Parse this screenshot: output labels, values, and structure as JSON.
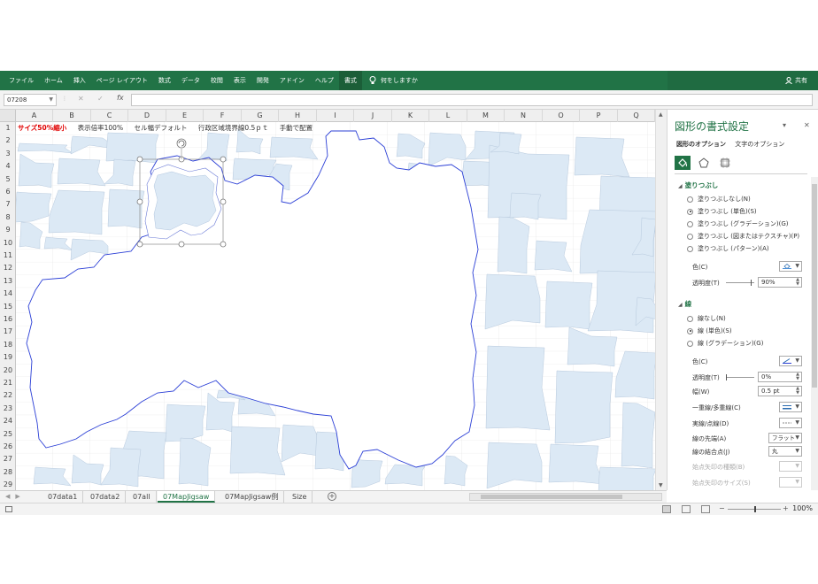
{
  "ribbon": {
    "tabs": [
      "ファイル",
      "ホーム",
      "挿入",
      "ページ レイアウト",
      "数式",
      "データ",
      "校閲",
      "表示",
      "開発",
      "アドイン",
      "ヘルプ",
      "書式"
    ],
    "active_tab": "書式",
    "tell_me": "何をしますか",
    "share": "共有"
  },
  "formula_bar": {
    "name_box": "07208",
    "formula": ""
  },
  "grid": {
    "columns": [
      "A",
      "B",
      "C",
      "D",
      "E",
      "F",
      "G",
      "H",
      "I",
      "J",
      "K",
      "L",
      "M",
      "N",
      "O",
      "P",
      "Q"
    ],
    "rows": [
      "1",
      "2",
      "3",
      "4",
      "5",
      "6",
      "7",
      "8",
      "9",
      "10",
      "11",
      "12",
      "13",
      "14",
      "15",
      "16",
      "17",
      "18",
      "19",
      "20",
      "21",
      "22",
      "23",
      "24",
      "25",
      "26",
      "27",
      "28",
      "29"
    ],
    "row1": {
      "red": "サイズ50%縮小",
      "zoom": "表示倍率100%",
      "cellwidth": "セル幅デフォルト",
      "border": "行政区域境界線0.5ｐｔ",
      "manual": "手動で配置"
    }
  },
  "sheets": {
    "tabs": [
      "07data1",
      "07data2",
      "07all",
      "07MapJigsaw",
      "07MapJigsaw例",
      "Size"
    ],
    "active": "07MapJigsaw"
  },
  "status": {
    "zoom": "100%"
  },
  "format_pane": {
    "title": "図形の書式設定",
    "tab_shape": "図形のオプション",
    "tab_text": "文字のオプション",
    "fill": {
      "section": "塗りつぶし",
      "options": [
        "塗りつぶしなし(N)",
        "塗りつぶし (単色)(S)",
        "塗りつぶし (グラデーション)(G)",
        "塗りつぶし (図またはテクスチャ)(P)",
        "塗りつぶし (パターン)(A)"
      ],
      "selected_index": 1,
      "color_label": "色(C)",
      "transparency_label": "透明度(T)",
      "transparency_value": "90%"
    },
    "line": {
      "section": "線",
      "options": [
        "線なし(N)",
        "線 (単色)(S)",
        "線 (グラデーション)(G)"
      ],
      "selected_index": 1,
      "color_label": "色(C)",
      "transparency_label": "透明度(T)",
      "transparency_value": "0%",
      "width_label": "幅(W)",
      "width_value": "0.5 pt",
      "compound_label": "一重線/多重線(C)",
      "dash_label": "実線/点線(D)",
      "cap_label": "線の先端(A)",
      "cap_value": "フラット",
      "join_label": "線の結合点(J)",
      "join_value": "丸",
      "arrow_type_label": "始点矢印の種類(B)",
      "arrow_size_label": "始点矢印のサイズ(S)"
    },
    "colors": {
      "accent": "#217346",
      "fill_color": "#dce9f5",
      "line_color": "#2b3fd6"
    }
  }
}
